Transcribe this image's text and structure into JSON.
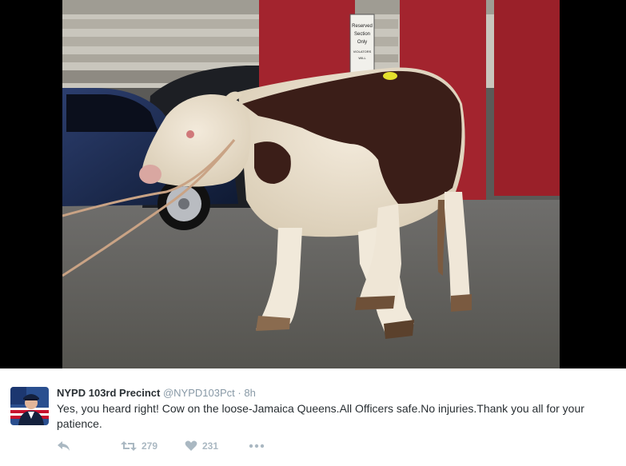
{
  "tweet": {
    "name": "NYPD 103rd Precinct",
    "handle": "@NYPD103Pct",
    "separator": "·",
    "time": "8h",
    "text": "Yes, you heard right! Cow on the loose-Jamaica Queens.All Officers safe.No injuries.Thank you all for your patience.",
    "retweets": "279",
    "likes": "231"
  },
  "photo": {
    "sign_lines": [
      "Reserved",
      "Section",
      "Only",
      "VIOLATORS",
      "WILL"
    ]
  },
  "colors": {
    "text": "#292f33",
    "secondary": "#8899a6",
    "action": "#aab8c2",
    "pillar": "#a3242e"
  },
  "icons": [
    "reply-icon",
    "retweet-icon",
    "heart-icon",
    "more-icon"
  ]
}
